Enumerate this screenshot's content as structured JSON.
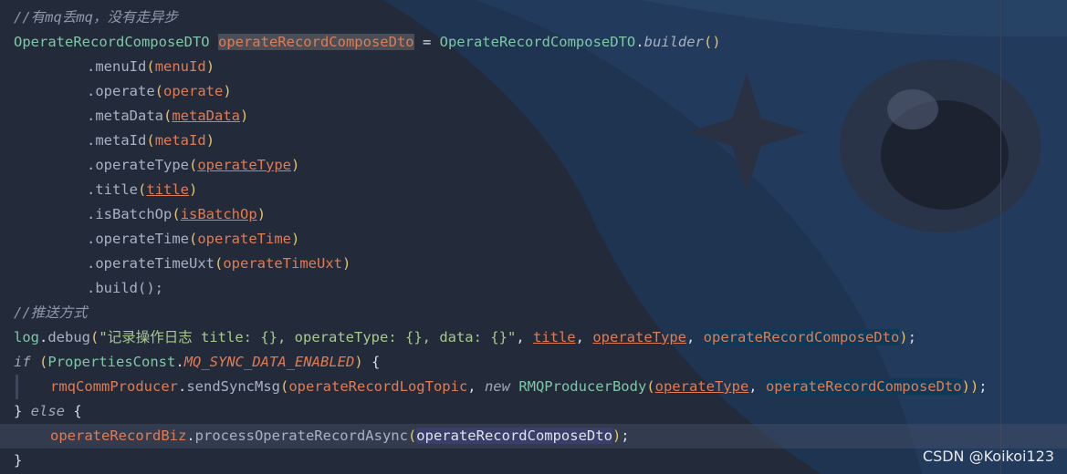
{
  "code": {
    "comment1": "//有mq丢mq，没有走异步",
    "l2_type": "OperateRecordComposeDTO",
    "l2_var": "operateRecordComposeDto",
    "l2_eq": " = ",
    "l2_type2": "OperateRecordComposeDTO",
    "l2_dot": ".",
    "l2_method": "builder",
    "l2_paren": "()",
    "chain": [
      {
        "method": "menuId",
        "arg": "menuId",
        "underline": false
      },
      {
        "method": "operate",
        "arg": "operate",
        "underline": false
      },
      {
        "method": "metaData",
        "arg": "metaData",
        "underline": true
      },
      {
        "method": "metaId",
        "arg": "metaId",
        "underline": false
      },
      {
        "method": "operateType",
        "arg": "operateType",
        "underline": true
      },
      {
        "method": "title",
        "arg": "title",
        "underline": true
      },
      {
        "method": "isBatchOp",
        "arg": "isBatchOp",
        "underline": true
      },
      {
        "method": "operateTime",
        "arg": "operateTime",
        "underline": false
      },
      {
        "method": "operateTimeUxt",
        "arg": "operateTimeUxt",
        "underline": false
      }
    ],
    "build": ".build();",
    "comment2": "//推送方式",
    "log_obj": "log",
    "log_method": "debug",
    "log_string": "\"记录操作日志 title: {}, operateType: {}, data: {}\"",
    "log_arg1": "title",
    "log_arg2": "operateType",
    "log_arg3": "operateRecordComposeDto",
    "if_kw": "if",
    "if_class": "PropertiesConst",
    "if_const": "MQ_SYNC_DATA_ENABLED",
    "producer": "rmqCommProducer",
    "send_method": "sendSyncMsg",
    "topic": "operateRecordLogTopic",
    "new_kw": "new",
    "body_type": "RMQProducerBody",
    "body_arg1": "operateType",
    "body_arg2": "operateRecordComposeDto",
    "else_kw": "else",
    "biz": "operateRecordBiz",
    "async_method": "processOperateRecordAsync",
    "async_arg": "operateRecordComposeDto",
    "close": "}"
  },
  "watermark": "CSDN @Koikoi123"
}
